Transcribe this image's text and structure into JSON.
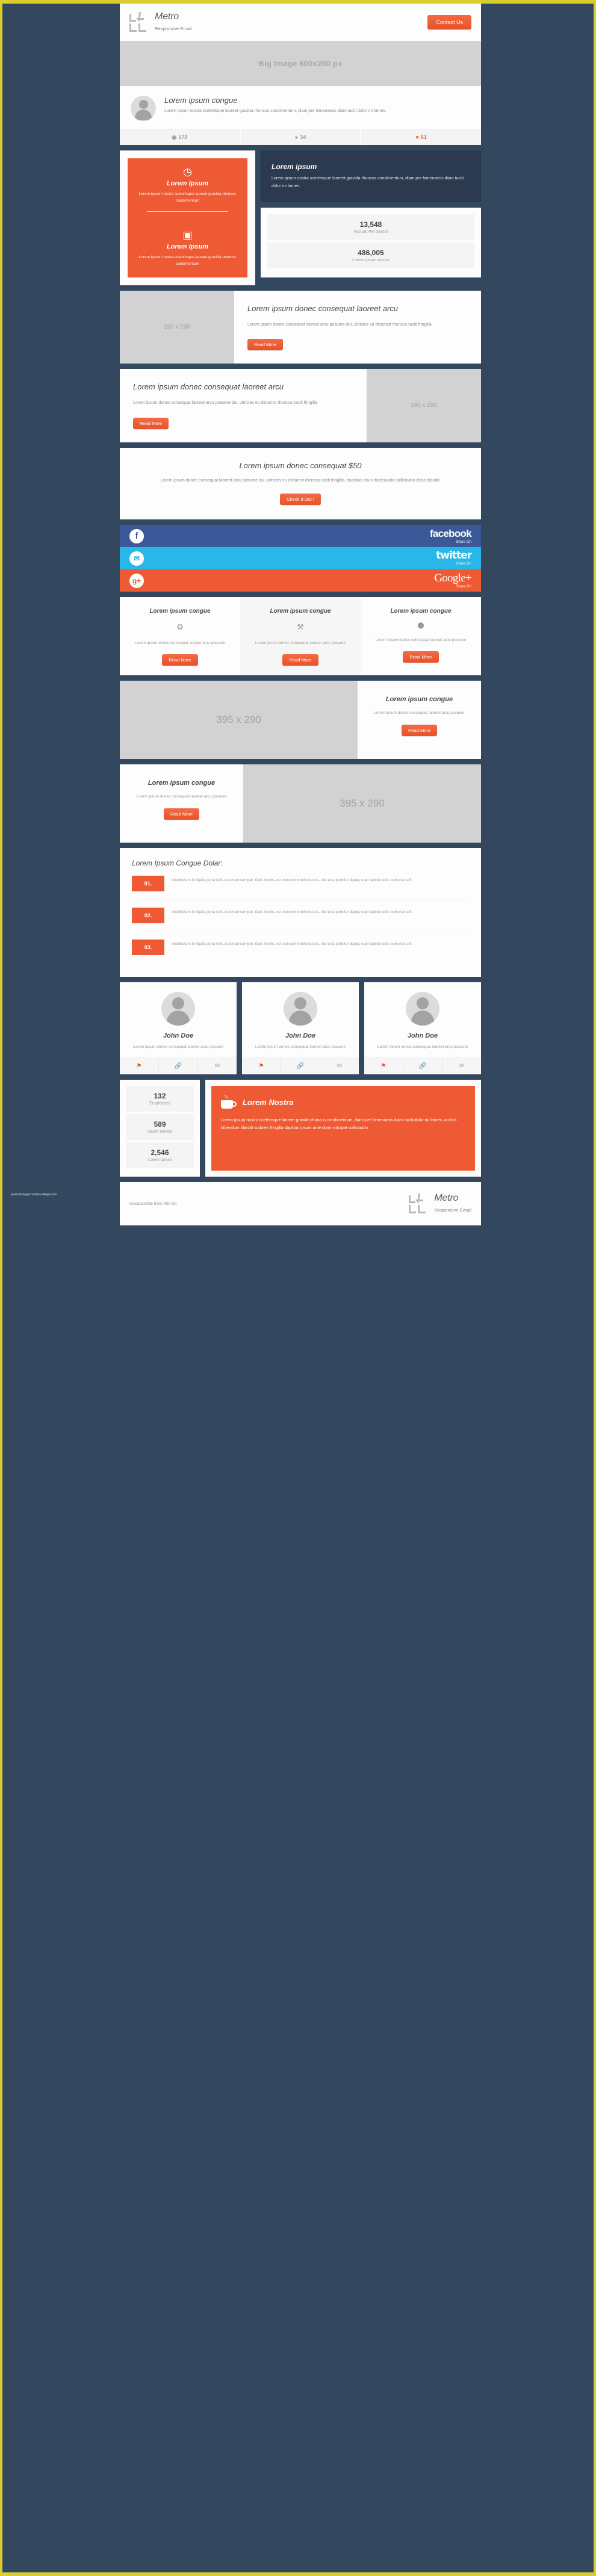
{
  "brand": {
    "name": "Metro",
    "tagline": "Responsive Email"
  },
  "header": {
    "contact_label": "Contact Us"
  },
  "hero": {
    "image_placeholder": "Big Image 600x200 px"
  },
  "profile": {
    "title": "Lorem ipsum congue",
    "body": "Lorem ipsum nostra scelerisque laoreet gravida rhoncus condimentum, diam per himenaeos diam taciti dolor mi fames.",
    "stats": [
      {
        "icon": "eye-icon",
        "glyph": "◉",
        "value": "172"
      },
      {
        "icon": "comment-icon",
        "glyph": "●",
        "value": "34"
      },
      {
        "icon": "heart-icon",
        "glyph": "♥",
        "value": "61"
      }
    ]
  },
  "features": {
    "tiles": [
      {
        "icon": "clock-icon",
        "glyph": "◷",
        "title": "Lorem Ipsum",
        "body": "Lorem ipsum nostra scelerisque laoreet gravida rhoncus condimentum"
      },
      {
        "icon": "monitor-icon",
        "glyph": "▣",
        "title": "Lorem Ipsum",
        "body": "Lorem ipsum nostra scelerisque laoreet gravida rhoncus condimentum"
      }
    ],
    "dark_panel": {
      "title": "Lorem ipsum",
      "body": "Lorem ipsum nostra scelerisque laoreet gravida rhoncus condimentum, diam per himenaeos diam taciti dolor mi fames."
    },
    "numbers": [
      {
        "value": "13,548",
        "label": "Visitors Per Month"
      },
      {
        "value": "486,005",
        "label": "Lorem ipsum nostra"
      }
    ]
  },
  "media_rows": [
    {
      "image_placeholder": "190 x 290",
      "title": "Lorem ipsum donec consequat laoreet arcu",
      "body": "Lorem ipsum donec consequat laoreet arcu posuere dui, ultricies eu dictumst rhoncus taciti fringilla",
      "button": "Read More"
    },
    {
      "image_placeholder": "190 x 290",
      "title": "Lorem ipsum donec consequat laoreet arcu",
      "body": "Lorem ipsum donec consequat laoreet arcu posuere dui, ultricies eu dictumst rhoncus taciti fringilla",
      "button": "Read More"
    }
  ],
  "cta": {
    "title": "Lorem ipsum donec consequat $50",
    "body": "Lorem ipsum donec consequat laoreet arcu posuere dui, ultricies eu dictumst rhoncus taciti fringilla, faucibus risus malesuada sollicitudin class blandit.",
    "button": "Check It Out !"
  },
  "social": [
    {
      "network": "facebook",
      "icon": "facebook-icon",
      "glyph": "f",
      "name": "facebook",
      "share": "Share On",
      "color": "#3b5998"
    },
    {
      "network": "twitter",
      "icon": "twitter-icon",
      "glyph": "✉",
      "name": "twitter",
      "share": "Share On",
      "color": "#29b6e8"
    },
    {
      "network": "googleplus",
      "icon": "google-plus-icon",
      "glyph": "g+",
      "name": "Google+",
      "share": "Share On",
      "color": "#ee5a34"
    }
  ],
  "cards": [
    {
      "title": "Lorem ipsum congue",
      "icon": "gear-icon",
      "glyph": "⚙",
      "body": "Lorem ipsum donec consequat laoreet arcu posuere",
      "button": "Read More"
    },
    {
      "title": "Lorem ipsum congue",
      "icon": "tools-icon",
      "glyph": "⚒",
      "body": "Lorem ipsum donec consequat laoreet arcu posuere",
      "button": "Read More"
    },
    {
      "title": "Lorem ipsum congue",
      "icon": "chat-icon",
      "glyph": "⬤",
      "body": "Lorem ipsum donec consequat laoreet arcu posuere",
      "button": "Read More"
    }
  ],
  "wide_rows": [
    {
      "image_placeholder": "395 x 290",
      "title": "Lorem ipsum congue",
      "body": "Lorem ipsum donec consequat laoreet arcu posuere",
      "button": "Read More"
    },
    {
      "image_placeholder": "395 x 290",
      "title": "Lorem ipsum congue",
      "body": "Lorem ipsum donec consequat laoreet arcu posuere",
      "button": "Read More"
    }
  ],
  "numbered_list": {
    "title": "Lorem Ipsum Congue Dolar:",
    "items": [
      {
        "number": "01.",
        "text": "Vestibulum id ligula porta felis euismod semper. Duis mollis, est non commodo luctus, nisi erat porttitor ligula, eget lacinia odio sem nec elit."
      },
      {
        "number": "02.",
        "text": "Vestibulum id ligula porta felis euismod semper. Duis mollis, est non commodo luctus, nisi erat porttitor ligula, eget lacinia odio sem nec elit."
      },
      {
        "number": "03.",
        "text": "Vestibulum id ligula porta felis euismod semper. Duis mollis, est non commodo luctus, nisi erat porttitor ligula, eget lacinia odio sem nec elit."
      }
    ]
  },
  "team": [
    {
      "name": "John Doe",
      "body": "Lorem ipsum donec consequat laoreet arcu posuere",
      "icons": [
        "award-icon",
        "link-icon",
        "mail-icon"
      ]
    },
    {
      "name": "John Doe",
      "body": "Lorem ipsum donec consequat laoreet arcu posuere",
      "icons": [
        "award-icon",
        "link-icon",
        "mail-icon"
      ]
    },
    {
      "name": "John Doe",
      "body": "Lorem ipsum donec consequat laoreet arcu posuere",
      "icons": [
        "award-icon",
        "link-icon",
        "mail-icon"
      ]
    }
  ],
  "bottom": {
    "stats": [
      {
        "value": "132",
        "label": "Employees"
      },
      {
        "value": "589",
        "label": "Ipsum Nostra"
      },
      {
        "value": "2,546",
        "label": "Lorem Ipsum"
      }
    ],
    "promo": {
      "icon": "coffee-cup-icon",
      "title": "Lorem Nostra",
      "body": "Lorem ipsum nostra scelerisque laoreet gravida rhoncus condimentum, diam per himenaeos diam taciti dolor mi fames. acilisis bibendum blandit sodales fringilla dapibus ipsum ante diam volutpat sollicitudin."
    }
  },
  "footer": {
    "unsubscribe": "Unsubscribe from this list"
  },
  "watermark": "www.heritagechristiancollege.com",
  "colors": {
    "accent": "#ee5a34",
    "dark": "#2b3a4e",
    "page_bg": "#33475f",
    "border": "#d9ce2e"
  }
}
